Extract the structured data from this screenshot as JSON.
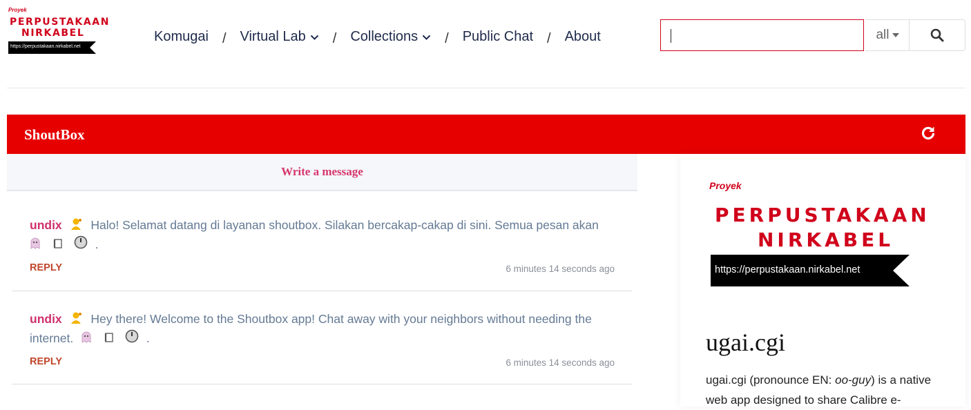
{
  "logo": {
    "small": "Proyek",
    "line1": "PERPUSTAKAAN",
    "line2": "NIRKABEL",
    "url": "https://perpustakaan.nirkabel.net"
  },
  "nav": {
    "items": [
      {
        "label": "Komugai"
      },
      {
        "label": "Virtual Lab"
      },
      {
        "label": "Collections"
      },
      {
        "label": "Public Chat"
      },
      {
        "label": "About"
      }
    ],
    "separator": "/"
  },
  "search": {
    "value": "",
    "filter": "all"
  },
  "shoutbox": {
    "title": "ShoutBox",
    "write_prompt": "Write a message",
    "messages": [
      {
        "user": "undix",
        "text_line1": "Halo! Selamat datang di layanan shoutbox. Silakan bercakap-cakap di sini. Semua pesan akan",
        "text_line2": ".",
        "reply": "REPLY",
        "time": "6 minutes 14 seconds ago"
      },
      {
        "user": "undix",
        "text_line1": "Hey there! Welcome to the Shoutbox app! Chat away with your neighbors without needing the",
        "text_line2_prefix": "internet.",
        "text_line2": ".",
        "reply": "REPLY",
        "time": "6 minutes 14 seconds ago"
      }
    ]
  },
  "panel": {
    "proyek": "Proyek",
    "line1": "PERPUSTAKAAN",
    "line2": "NIRKABEL",
    "url": "https://perpustakaan.nirkabel.net",
    "title": "ugai.cgi",
    "desc_a": "ugai.cgi (pronounce EN: ",
    "desc_em": "oo-guy",
    "desc_b": ") is a native web app designed to share Calibre e-"
  },
  "colors": {
    "brand_red": "#e60000",
    "logo_red": "#d0021b",
    "username": "#d0306b",
    "reply": "#c0452a",
    "nav_text": "#1e2a4a"
  }
}
